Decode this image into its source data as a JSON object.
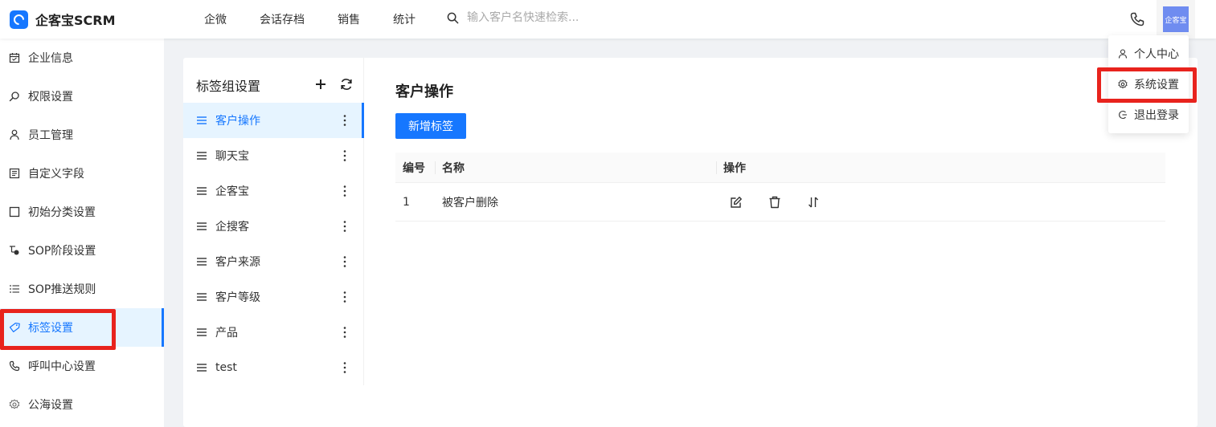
{
  "header": {
    "logo_text": "企客宝SCRM",
    "nav": [
      "企微",
      "会话存档",
      "销售",
      "统计"
    ],
    "search_placeholder": "输入客户名快速检索...",
    "avatar_text": "企客宝"
  },
  "dropdown": {
    "items": [
      "个人中心",
      "系统设置",
      "退出登录"
    ]
  },
  "sidebar": {
    "items": [
      "企业信息",
      "权限设置",
      "员工管理",
      "自定义字段",
      "初始分类设置",
      "SOP阶段设置",
      "SOP推送规则",
      "标签设置",
      "呼叫中心设置",
      "公海设置"
    ],
    "active": "标签设置"
  },
  "group_panel": {
    "title": "标签组设置",
    "items": [
      "客户操作",
      "聊天宝",
      "企客宝",
      "企搜客",
      "客户来源",
      "客户等级",
      "产品",
      "test"
    ],
    "active": "客户操作"
  },
  "main": {
    "title": "客户操作",
    "add_button": "新增标签",
    "columns": [
      "编号",
      "名称",
      "操作"
    ],
    "rows": [
      {
        "id": "1",
        "name": "被客户删除"
      }
    ]
  },
  "colors": {
    "primary": "#1677ff",
    "highlight_box": "#e8231d",
    "avatar_bg": "#6f8cf0"
  },
  "icons": {
    "search": "search-icon",
    "phone": "phone-icon",
    "user": "user-icon",
    "settings": "gear-icon",
    "logout": "logout-icon",
    "add": "plus-icon",
    "refresh": "refresh-icon",
    "menu": "menu-icon",
    "more": "more-vertical-icon",
    "edit": "edit-icon",
    "delete": "trash-icon",
    "sort": "sort-icon"
  }
}
